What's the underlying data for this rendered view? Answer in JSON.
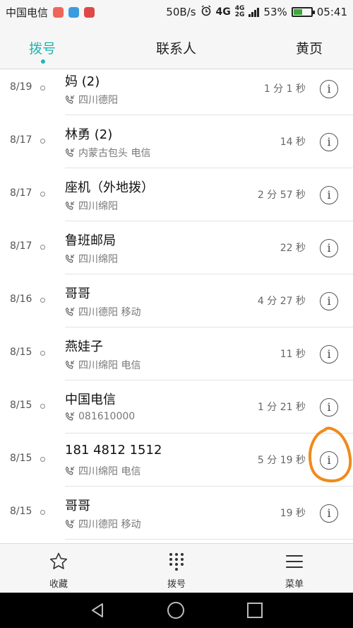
{
  "status_bar": {
    "carrier": "中国电信",
    "speed": "50B/s",
    "network": "4G",
    "net_top": "4G",
    "net_bottom": "2G",
    "battery": "53%",
    "battery_level": 0.53,
    "time": "05:41"
  },
  "tabs": [
    {
      "label": "拨号",
      "active": true
    },
    {
      "label": "联系人",
      "active": false
    },
    {
      "label": "黄页",
      "active": false
    }
  ],
  "calls": [
    {
      "date": "8/19",
      "name": "妈 (2)",
      "location": "四川德阳",
      "duration": "1 分 1 秒"
    },
    {
      "date": "8/17",
      "name": "林勇 (2)",
      "location": "内蒙古包头 电信",
      "duration": "14 秒"
    },
    {
      "date": "8/17",
      "name": "座机（外地拨）",
      "location": "四川绵阳",
      "duration": "2 分 57 秒"
    },
    {
      "date": "8/17",
      "name": "鲁班邮局",
      "location": "四川绵阳",
      "duration": "22 秒"
    },
    {
      "date": "8/16",
      "name": "哥哥",
      "location": "四川德阳 移动",
      "duration": "4 分 27 秒"
    },
    {
      "date": "8/15",
      "name": "燕娃子",
      "location": "四川绵阳 电信",
      "duration": "11 秒"
    },
    {
      "date": "8/15",
      "name": "中国电信",
      "location": "081610000",
      "duration": "1 分 21 秒"
    },
    {
      "date": "8/15",
      "name": "181 4812 1512",
      "location": "四川绵阳 电信",
      "duration": "5 分 19 秒"
    },
    {
      "date": "8/15",
      "name": "哥哥",
      "location": "四川德阳 移动",
      "duration": "19 秒"
    }
  ],
  "bottom_bar": {
    "favorites": "收藏",
    "dialpad": "拨号",
    "menu": "菜单"
  },
  "colors": {
    "accent": "#1fb5b1",
    "annotation": "#f08a1c"
  }
}
